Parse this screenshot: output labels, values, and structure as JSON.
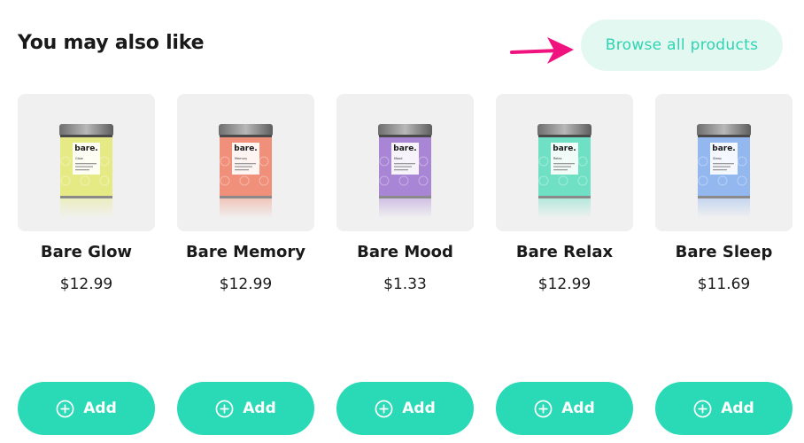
{
  "section": {
    "title": "You may also like",
    "browse_label": "Browse all products"
  },
  "colors": {
    "accent": "#2ad9b5",
    "browse_bg": "#e3f8f1",
    "browse_text": "#2ed3b1",
    "arrow": "#f0127f"
  },
  "add_label": "Add",
  "add_icon": "plus-circle-icon",
  "products": [
    {
      "name": "Bare Glow",
      "price": "$12.99",
      "brand": "bare.",
      "label": "Glow",
      "tin_color": "#e6ea84"
    },
    {
      "name": "Bare Memory",
      "price": "$12.99",
      "brand": "bare.",
      "label": "Memory",
      "tin_color": "#f0907a"
    },
    {
      "name": "Bare Mood",
      "price": "$1.33",
      "brand": "bare.",
      "label": "Mood",
      "tin_color": "#a985d6"
    },
    {
      "name": "Bare Relax",
      "price": "$12.99",
      "brand": "bare.",
      "label": "Relax",
      "tin_color": "#6fe0c4"
    },
    {
      "name": "Bare Sleep",
      "price": "$11.69",
      "brand": "bare.",
      "label": "Sleep",
      "tin_color": "#93b7ef"
    }
  ]
}
